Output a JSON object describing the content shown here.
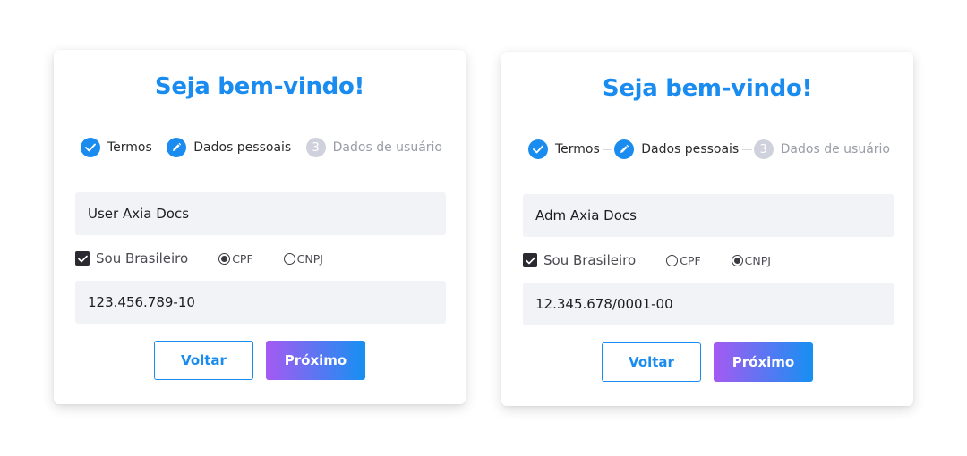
{
  "cards": [
    {
      "title": "Seja bem-vindo!",
      "steps": [
        {
          "label": "Termos",
          "state": "done",
          "icon": "check-icon"
        },
        {
          "label": "Dados pessoais",
          "state": "active",
          "icon": "pencil-icon"
        },
        {
          "label": "Dados de usuário",
          "state": "pending",
          "number": "3"
        }
      ],
      "name_value": "User Axia Docs",
      "brasileiro_label": "Sou Brasileiro",
      "brasileiro_checked": true,
      "radio_cpf_label": "CPF",
      "radio_cnpj_label": "CNPJ",
      "selected_doc_type": "CPF",
      "doc_value": "123.456.789-10",
      "back_label": "Voltar",
      "next_label": "Próximo"
    },
    {
      "title": "Seja bem-vindo!",
      "steps": [
        {
          "label": "Termos",
          "state": "done",
          "icon": "check-icon"
        },
        {
          "label": "Dados pessoais",
          "state": "active",
          "icon": "pencil-icon"
        },
        {
          "label": "Dados de usuário",
          "state": "pending",
          "number": "3"
        }
      ],
      "name_value": "Adm Axia Docs",
      "brasileiro_label": "Sou Brasileiro",
      "brasileiro_checked": true,
      "radio_cpf_label": "CPF",
      "radio_cnpj_label": "CNPJ",
      "selected_doc_type": "CNPJ",
      "doc_value": "12.345.678/0001-00",
      "back_label": "Voltar",
      "next_label": "Próximo"
    }
  ],
  "colors": {
    "accent": "#1a8cf0",
    "gradient_start": "#a55af2",
    "gradient_end": "#1690f2",
    "field_bg": "#f2f3f7",
    "pending_step": "#cfd2dc"
  }
}
